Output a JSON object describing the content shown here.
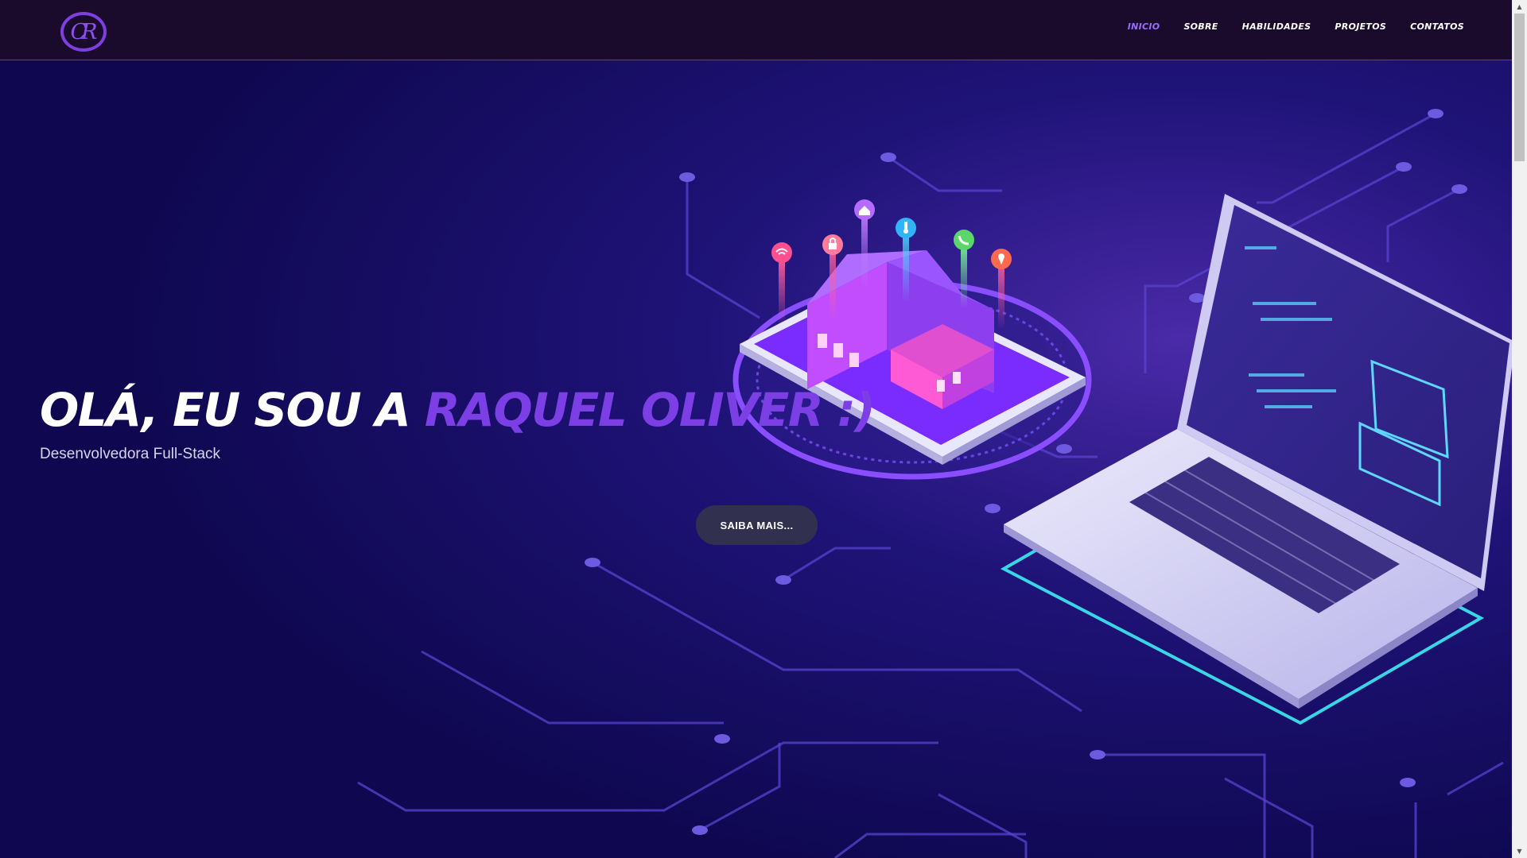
{
  "header": {
    "logo": "CR",
    "nav": [
      "INICIO",
      "SOBRE",
      "HABILIDADES",
      "PROJETOS",
      "CONTATOS"
    ],
    "active_nav": "INICIO"
  },
  "hero": {
    "title_prefix": "OLÁ, EU SOU A ",
    "title_name": "RAQUEL OLIVER :)",
    "subtitle": "Desenvolvedora Full-Stack",
    "cta_label": "SAIBA MAIS..."
  },
  "colors": {
    "background": "#100a55",
    "header": "#1a0b2c",
    "accent": "#7c3fe6",
    "active_nav": "#9b6cff",
    "button": "#31304e"
  },
  "icons": [
    "wifi-icon",
    "lock-icon",
    "home-icon",
    "thermometer-icon",
    "phone-icon",
    "location-pin-icon"
  ],
  "scrollbar": {
    "up": "▲",
    "down": "▼"
  }
}
